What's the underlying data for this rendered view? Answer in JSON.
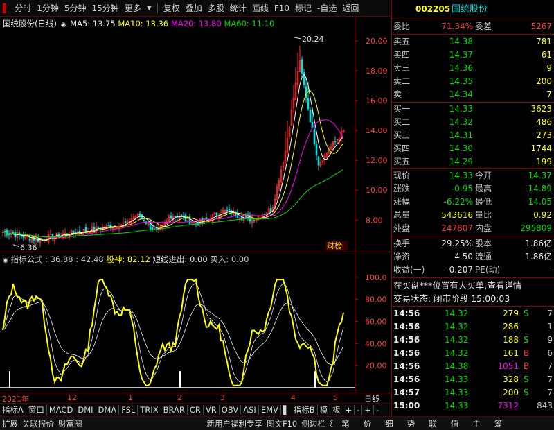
{
  "toolbar": {
    "items": [
      "分时",
      "1分钟",
      "5分钟",
      "15分钟",
      "更多",
      "复权",
      "叠加",
      "多股",
      "统计",
      "画线",
      "F10",
      "标记",
      "-自选",
      "返回"
    ]
  },
  "main_chart": {
    "stock_label": "国统股份(日线)",
    "ma5": "MA5: 13.75",
    "ma10": "MA10: 13.36",
    "ma20": "MA20: 13.80",
    "ma60": "MA60: 11.10",
    "high_marker": "20.24",
    "low_marker": "6.36",
    "badge": "财榜",
    "y_ticks": [
      "20.00",
      "18.00",
      "16.00",
      "14.00",
      "12.00",
      "10.00",
      "8.00"
    ],
    "colors": {
      "ma5": "#ffffff",
      "ma10": "#ffff00",
      "ma20": "#ff00ff",
      "ma60": "#00e000",
      "up": "#ff3232",
      "down": "#00e0e0"
    }
  },
  "indicator": {
    "title": "指标公式 : 36.88 : 42.48",
    "shenshen": "股神: 82.12",
    "short_line": "短线进出: 0.00",
    "buy": "买入: 0.00",
    "y_ticks": [
      "100.0",
      "80.00",
      "60.00",
      "40.00",
      "20.00"
    ]
  },
  "time_axis": {
    "labels": [
      "2021年",
      "12",
      "1",
      "2",
      "3",
      "4",
      "5"
    ],
    "right_label": "日线"
  },
  "tabs": [
    "指标A",
    "窗口",
    "MACD",
    "DMI",
    "DMA",
    "FSL",
    "TRIX",
    "BRAR",
    "CR",
    "VR",
    "OBV",
    "ASI",
    "EMV",
    "指标B",
    "模",
    "板",
    "+",
    "-",
    "+",
    "-"
  ],
  "statusbar": {
    "left": [
      "扩展",
      "关联报价",
      "财富圈"
    ],
    "mid": [
      "新用户福利专享",
      "图文F10",
      "侧边栏《"
    ],
    "right": [
      "笔",
      "价",
      "细",
      "势",
      "联",
      "值",
      "主",
      "筹"
    ]
  },
  "quote": {
    "code": "002205",
    "name": "国统股份",
    "weibi_label": "委比",
    "weibi": "71.34%",
    "weicha_label": "委差",
    "weicha": "5267",
    "sell": [
      {
        "label": "卖五",
        "price": "14.38",
        "vol": "781"
      },
      {
        "label": "卖四",
        "price": "14.37",
        "vol": "61"
      },
      {
        "label": "卖三",
        "price": "14.36",
        "vol": "9"
      },
      {
        "label": "卖二",
        "price": "14.35",
        "vol": "200"
      },
      {
        "label": "卖一",
        "price": "14.34",
        "vol": "7"
      }
    ],
    "buy": [
      {
        "label": "买一",
        "price": "14.33",
        "vol": "3623"
      },
      {
        "label": "买二",
        "price": "14.32",
        "vol": "486"
      },
      {
        "label": "买三",
        "price": "14.31",
        "vol": "273"
      },
      {
        "label": "买四",
        "price": "14.30",
        "vol": "1744"
      },
      {
        "label": "买五",
        "price": "14.29",
        "vol": "199"
      }
    ],
    "stats": [
      {
        "l1": "现价",
        "v1": "14.33",
        "c1": "green",
        "l2": "今开",
        "v2": "14.37",
        "c2": "green"
      },
      {
        "l1": "涨跌",
        "v1": "-0.95",
        "c1": "green",
        "l2": "最高",
        "v2": "14.89",
        "c2": "green"
      },
      {
        "l1": "涨幅",
        "v1": "-6.22%",
        "c1": "green",
        "l2": "最低",
        "v2": "14.05",
        "c2": "green"
      },
      {
        "l1": "总量",
        "v1": "543616",
        "c1": "yellow",
        "l2": "量比",
        "v2": "0.92",
        "c2": "yellow"
      },
      {
        "l1": "外盘",
        "v1": "247807",
        "c1": "red",
        "l2": "内盘",
        "v2": "295809",
        "c2": "green"
      }
    ],
    "fund": [
      {
        "l1": "换手",
        "v1": "29.25%",
        "l2": "股本",
        "v2": "1.86亿"
      },
      {
        "l1": "净资",
        "v1": "4.50",
        "l2": "流通",
        "v2": "1.86亿"
      },
      {
        "l1": "收益(一)",
        "v1": "-0.207",
        "l2": "PE(动)",
        "v2": "-"
      }
    ],
    "notice": "在买盘***位置有大买单,查看详情",
    "trade_state": "交易状态: 闭市阶段 15:00:03",
    "ticks": [
      {
        "t": "14:56",
        "p": "14.32",
        "v": "279",
        "d": "S"
      },
      {
        "t": "14:56",
        "p": "14.32",
        "v": "286",
        "d": ""
      },
      {
        "t": "14:56",
        "p": "14.32",
        "v": "188",
        "d": "S"
      },
      {
        "t": "14:56",
        "p": "14.32",
        "v": "161",
        "d": "B"
      },
      {
        "t": "14:56",
        "p": "14.38",
        "v": "1051",
        "d": "B"
      },
      {
        "t": "14:56",
        "p": "14.33",
        "v": "328",
        "d": "S"
      },
      {
        "t": "14:57",
        "p": "14.33",
        "v": "200",
        "d": "S"
      },
      {
        "t": "15:00",
        "p": "14.33",
        "v": "7312",
        "d": ""
      }
    ],
    "tick_tail": [
      "7",
      "1",
      "9",
      "6",
      "7",
      "7",
      "7",
      "843"
    ]
  }
}
